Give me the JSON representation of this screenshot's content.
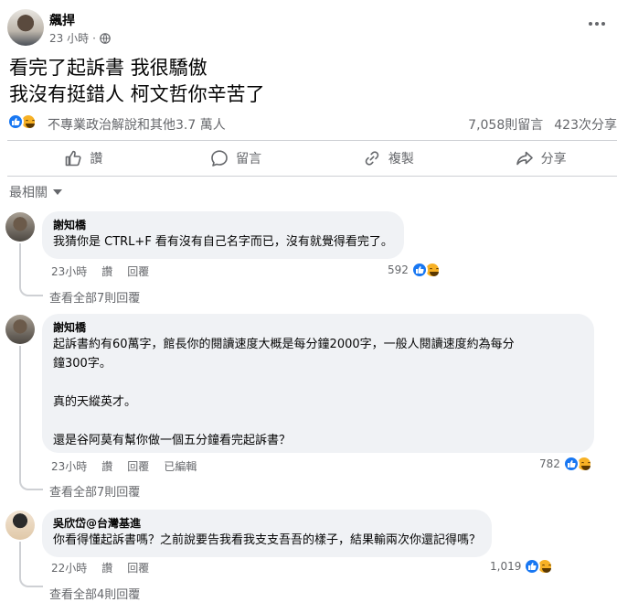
{
  "post": {
    "author": "飆捍",
    "time": "23 小時",
    "lines": [
      "看完了起訴書 我很驕傲",
      "我沒有挺錯人 柯文哲你辛苦了"
    ],
    "reactors": "不專業政治解說和其他3.7 萬人",
    "comment_count": "7,058則留言",
    "share_count": "423次分享"
  },
  "actions": {
    "like": "讚",
    "comment": "留言",
    "copy": "複製",
    "share": "分享"
  },
  "sort_label": "最相關",
  "comments": [
    {
      "name": "謝知橋",
      "text": "我猜你是 CTRL+F 看有沒有自己名字而已，沒有就覺得看完了。",
      "time": "23小時",
      "like": "讚",
      "reply": "回覆",
      "edited": "",
      "reactions": "592",
      "view_replies": "查看全部7則回覆"
    },
    {
      "name": "謝知橋",
      "text": "起訴書約有60萬字，館長你的閱讀速度大概是每分鐘2000字，一般人閱讀速度約為每分\n鐘300字。\n\n真的天縱英才。\n\n還是谷阿莫有幫你做一個五分鐘看完起訴書？",
      "time": "23小時",
      "like": "讚",
      "reply": "回覆",
      "edited": "已編輯",
      "reactions": "782",
      "view_replies": "查看全部7則回覆"
    },
    {
      "name": "吳欣岱@台灣基進",
      "text": "你看得懂起訴書嗎？之前說要告我看我支支吾吾的樣子，結果輸兩次你還記得嗎？",
      "time": "22小時",
      "like": "讚",
      "reply": "回覆",
      "edited": "",
      "reactions": "1,019",
      "view_replies": "查看全部4則回覆"
    }
  ],
  "colors": {
    "accent": "#1877f2",
    "haha": "#f7b125",
    "secondary_text": "#65676b",
    "bubble": "#f0f2f5"
  }
}
